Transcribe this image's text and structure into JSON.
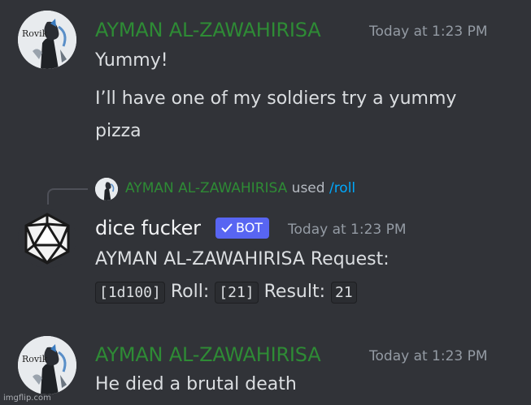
{
  "messages": [
    {
      "username": "AYMAN AL-ZAWAHIRISA",
      "timestamp": "Today at 1:23 PM",
      "avatar_text": "Rovik",
      "lines": [
        "Yummy!",
        "I’ll have one of my soldiers try a yummy",
        "pizza"
      ]
    },
    {
      "reply": {
        "username": "AYMAN AL-ZAWAHIRISA",
        "used": "used",
        "command": "/roll"
      },
      "username": "dice fucker",
      "bot_tag": "BOT",
      "timestamp": "Today at 1:23 PM",
      "line1": "AYMAN AL-ZAWAHIRISA Request:",
      "request_code": "[1d100]",
      "roll_label": "Roll:",
      "roll_code": "[21]",
      "result_label": "Result:",
      "result_value": "21"
    },
    {
      "username": "AYMAN AL-ZAWAHIRISA",
      "timestamp": "Today at 1:23 PM",
      "avatar_text": "Rovik",
      "lines": [
        "He died a brutal death"
      ]
    }
  ],
  "watermark": "imgflip.com",
  "colors": {
    "background": "#313338",
    "username_role": "#2e8b35",
    "timestamp": "#949ba4",
    "text": "#dbdee1",
    "bot_tag": "#5865f2",
    "command": "#00a8fc"
  },
  "icons": [
    "avatar-rovik-icon",
    "d20-icon",
    "checkmark-icon"
  ]
}
